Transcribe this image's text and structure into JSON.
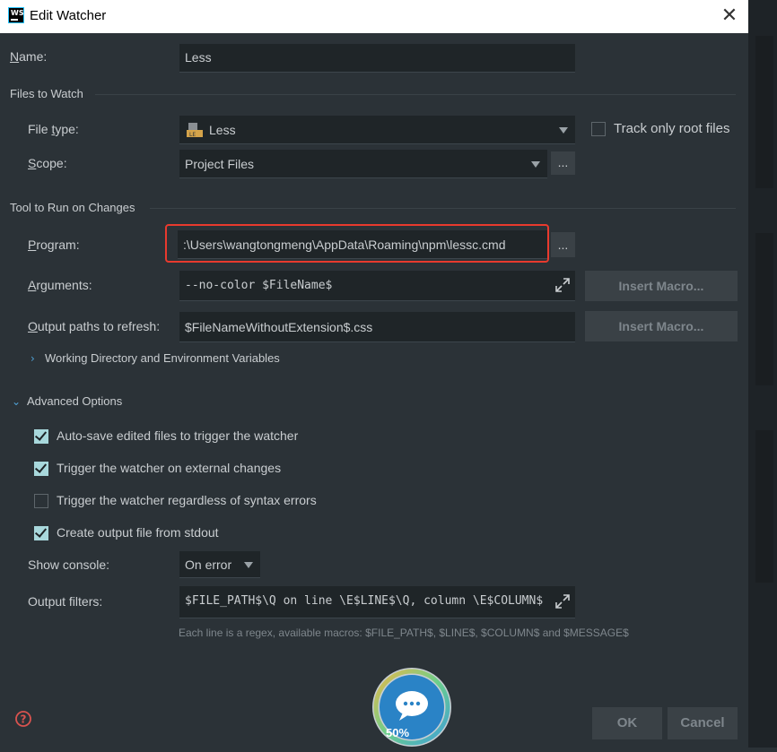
{
  "window": {
    "title": "Edit Watcher",
    "app_icon_text": "WS"
  },
  "name": {
    "label": "Name:",
    "mnemonic": "N",
    "label_rest": "ame:",
    "value": "Less"
  },
  "files_to_watch": {
    "section_title": "Files to Watch",
    "file_type": {
      "label_pre": "File ",
      "mnemonic": "t",
      "label_post": "ype:",
      "value": "Less"
    },
    "track_root": {
      "label": "Track only root files",
      "checked": false
    },
    "scope": {
      "mnemonic": "S",
      "label_rest": "cope:",
      "value": "Project Files",
      "browse_label": "..."
    }
  },
  "tool": {
    "section_title": "Tool to Run on Changes",
    "program": {
      "mnemonic": "P",
      "label_rest": "rogram:",
      "value": ":\\Users\\wangtongmeng\\AppData\\Roaming\\npm\\lessc.cmd",
      "browse_label": "..."
    },
    "arguments": {
      "mnemonic": "A",
      "label_rest": "rguments:",
      "value": "--no-color $FileName$",
      "macro_label": "Insert Macro..."
    },
    "output_paths": {
      "mnemonic": "O",
      "label_rest": "utput paths to refresh:",
      "value": "$FileNameWithoutExtension$.css",
      "macro_label": "Insert Macro..."
    },
    "working_dir": {
      "label": "Working Directory and Environment Variables"
    }
  },
  "advanced": {
    "section_title": "Advanced Options",
    "options": [
      {
        "label": "Auto-save edited files to trigger the watcher",
        "checked": true
      },
      {
        "label": "Trigger the watcher on external changes",
        "checked": true
      },
      {
        "label": "Trigger the watcher regardless of syntax errors",
        "checked": false
      },
      {
        "label": "Create output file from stdout",
        "checked": true
      }
    ],
    "show_console": {
      "label": "Show console:",
      "value": "On error"
    },
    "output_filters": {
      "label": "Output filters:",
      "value": "$FILE_PATH$\\Q on line \\E$LINE$\\Q, column \\E$COLUMN$",
      "hint": "Each line is a regex, available macros: $FILE_PATH$, $LINE$, $COLUMN$ and $MESSAGE$"
    }
  },
  "footer": {
    "help_icon": "question-circle-icon",
    "ok_label": "OK",
    "cancel_label": "Cancel",
    "progress_label": "50%"
  },
  "colors": {
    "accent": "#4fa3d8",
    "highlight": "#e83a2e",
    "checkbox": "#a8d8dc",
    "background": "#2b3237"
  }
}
